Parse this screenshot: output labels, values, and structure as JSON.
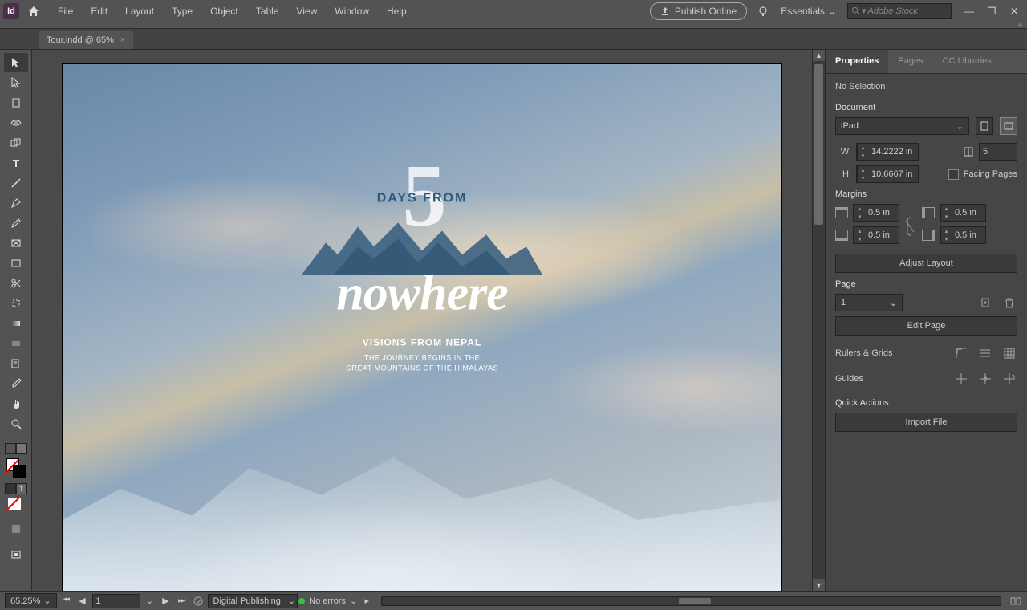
{
  "app": {
    "name": "Id"
  },
  "menu": [
    "File",
    "Edit",
    "Layout",
    "Type",
    "Object",
    "Table",
    "View",
    "Window",
    "Help"
  ],
  "header": {
    "publish": "Publish Online",
    "workspace": "Essentials",
    "search_placeholder": "Adobe Stock"
  },
  "tab": {
    "title": "Tour.indd @ 65%"
  },
  "canvas": {
    "big_num": "5",
    "days_from": "DAYS FROM",
    "nowhere": "nowhere",
    "sub1": "VISIONS FROM NEPAL",
    "sub2a": "THE JOURNEY BEGINS IN THE",
    "sub2b": "GREAT MOUNTAINS OF THE HIMALAYAS"
  },
  "status": {
    "zoom": "65.25%",
    "page": "1",
    "intent": "Digital Publishing",
    "errors": "No errors"
  },
  "panel": {
    "tabs": [
      "Properties",
      "Pages",
      "CC Libraries"
    ],
    "selection": "No Selection",
    "doc_label": "Document",
    "preset": "iPad",
    "w": "14.2222 in",
    "h": "10.6667 in",
    "pages_label": "5",
    "facing": "Facing Pages",
    "margins_label": "Margins",
    "m_top": "0.5 in",
    "m_bot": "0.5 in",
    "m_left": "0.5 in",
    "m_right": "0.5 in",
    "adjust_layout": "Adjust Layout",
    "page_section": "Page",
    "page_no": "1",
    "edit_page": "Edit Page",
    "rulers": "Rulers & Grids",
    "guides": "Guides",
    "quick": "Quick Actions",
    "import": "Import File"
  },
  "dim_labels": {
    "w": "W:",
    "h": "H:"
  }
}
